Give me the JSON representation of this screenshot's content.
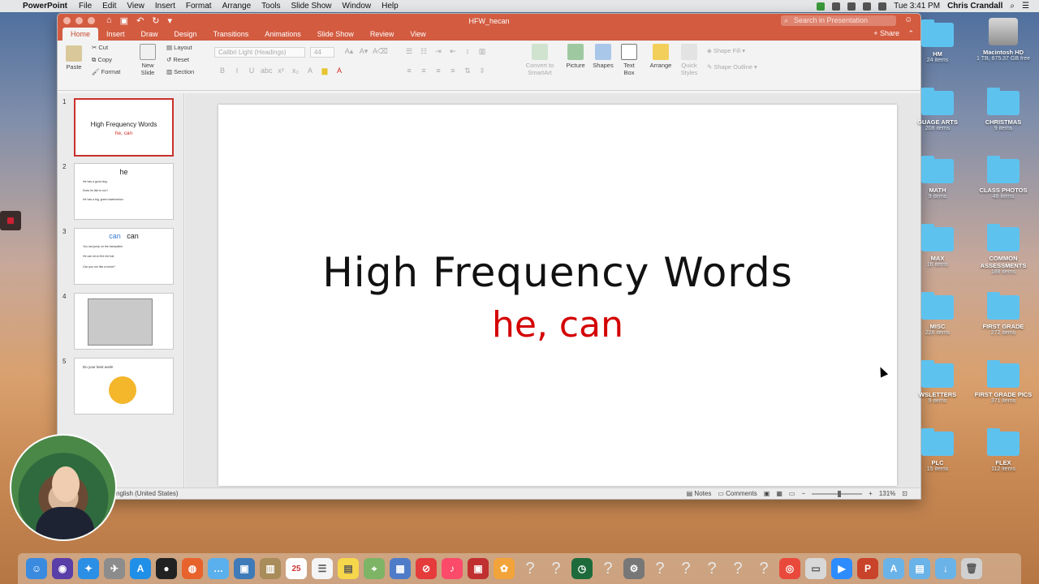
{
  "menubar": {
    "app_name": "PowerPoint",
    "items": [
      "File",
      "Edit",
      "View",
      "Insert",
      "Format",
      "Arrange",
      "Tools",
      "Slide Show",
      "Window",
      "Help"
    ],
    "clock": "Tue 3:41 PM",
    "user": "Chris Crandall"
  },
  "window": {
    "doc_title": "HFW_hecan",
    "search_placeholder": "Search in Presentation",
    "share_label": "Share",
    "tabs": [
      "Home",
      "Insert",
      "Draw",
      "Design",
      "Transitions",
      "Animations",
      "Slide Show",
      "Review",
      "View"
    ],
    "active_tab": "Home"
  },
  "ribbon": {
    "paste": "Paste",
    "cut": "Cut",
    "copy": "Copy",
    "format": "Format",
    "new_slide": "New Slide",
    "layout": "Layout",
    "reset": "Reset",
    "section": "Section",
    "font_name": "Calibri Light (Headings)",
    "font_size": "44",
    "convert_smartart": "Convert to SmartArt",
    "picture": "Picture",
    "shapes": "Shapes",
    "text_box": "Text Box",
    "arrange": "Arrange",
    "quick_styles": "Quick Styles",
    "shape_fill": "Shape Fill",
    "shape_outline": "Shape Outline"
  },
  "slides": [
    {
      "num": "1",
      "title": "High Frequency Words",
      "sub": "he, can"
    },
    {
      "num": "2",
      "title": "he",
      "lines": [
        "He has a good dog.",
        "Does he like to run?",
        "He has a big, green watermelon."
      ]
    },
    {
      "num": "3",
      "title_a": "can",
      "title_b": "can",
      "lines": [
        "You can jump on the trampoline.",
        "He can sit on the red hat.",
        "Can you run like a horse?"
      ]
    },
    {
      "num": "4"
    },
    {
      "num": "5",
      "line": "Do your best work!"
    }
  ],
  "main_slide": {
    "title": "High Frequency Words",
    "subtitle": "he, can"
  },
  "statusbar": {
    "language": "nglish (United States)",
    "notes": "Notes",
    "comments": "Comments",
    "zoom": "131%"
  },
  "desktop": [
    {
      "name": "HM",
      "count": "24 items"
    },
    {
      "name": "Macintosh HD",
      "count": "1 TB, 875.37 GB free"
    },
    {
      "name": "GUAGE ARTS",
      "count": "208 items"
    },
    {
      "name": "CHRISTMAS",
      "count": "9 items"
    },
    {
      "name": "MATH",
      "count": "9 items"
    },
    {
      "name": "CLASS PHOTOS",
      "count": "48 items"
    },
    {
      "name": "MAX",
      "count": "16 items"
    },
    {
      "name": "COMMON ASSESSMENTS",
      "count": "188 items"
    },
    {
      "name": "MISC",
      "count": "228 items"
    },
    {
      "name": "FIRST GRADE",
      "count": "272 items"
    },
    {
      "name": "WSLETTERS",
      "count": "9 items"
    },
    {
      "name": "FIRST GRADE PICS",
      "count": "371 items"
    },
    {
      "name": "PLC",
      "count": "15 items"
    },
    {
      "name": "FLEX",
      "count": "112 items"
    }
  ],
  "dock_date": "25",
  "colors": {
    "accent": "#d35b40",
    "red_text": "#d40000"
  }
}
